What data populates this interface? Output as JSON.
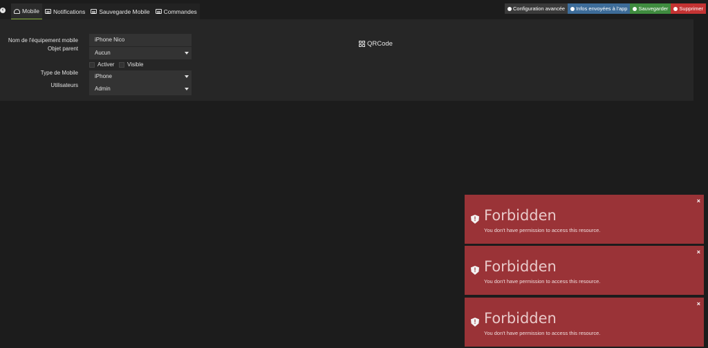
{
  "colors": {
    "background": "#1c1c1c",
    "panel": "#262626",
    "active_tab_underline": "#8bb33e",
    "infos_btn": "#3d6c99",
    "save_btn": "#3f8c3f",
    "delete_btn": "#c43333",
    "toast_bg": "#9a3337"
  },
  "nav": {
    "back_icon": "arrow-left-circle-icon",
    "tabs": [
      {
        "label": "Mobile",
        "icon": "gauge-icon",
        "active": true
      },
      {
        "label": "Notifications",
        "icon": "list-icon",
        "active": false
      },
      {
        "label": "Sauvegarde Mobile",
        "icon": "list-icon",
        "active": false
      },
      {
        "label": "Commandes",
        "icon": "list-icon",
        "active": false
      }
    ]
  },
  "actions": {
    "config": {
      "label": "Configuration avancée",
      "icon": "cogs-icon"
    },
    "infos": {
      "label": "Infos envoyées à l'app",
      "icon": "question-circle-icon"
    },
    "save": {
      "label": "Sauvegarder",
      "icon": "check-circle-icon"
    },
    "delete": {
      "label": "Supprimer",
      "icon": "minus-circle-icon"
    }
  },
  "form": {
    "name": {
      "label": "Nom de l'équipement mobile",
      "value": "iPhone Nico"
    },
    "parent": {
      "label": "Objet parent",
      "value": "Aucun"
    },
    "activer": {
      "label": "Activer",
      "checked": false
    },
    "visible": {
      "label": "Visible",
      "checked": false
    },
    "type": {
      "label": "Type de Mobile",
      "value": "iPhone"
    },
    "users": {
      "label": "Utilisateurs",
      "value": "Admin"
    }
  },
  "qrcode": {
    "label": "QRCode",
    "icon": "qrcode-icon"
  },
  "toasts": [
    {
      "title": "Forbidden",
      "message": "You don't have permission to access this resource.",
      "close": "×"
    },
    {
      "title": "Forbidden",
      "message": "You don't have permission to access this resource.",
      "close": "×"
    },
    {
      "title": "Forbidden",
      "message": "You don't have permission to access this resource.",
      "close": "×"
    }
  ]
}
